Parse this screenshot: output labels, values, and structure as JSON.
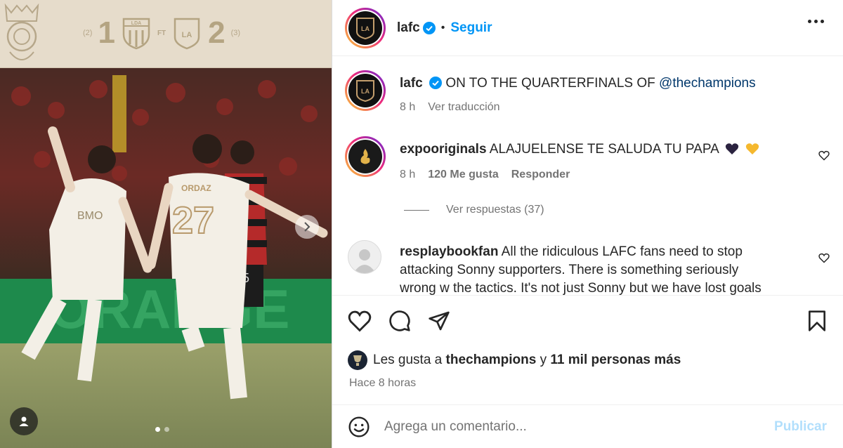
{
  "scoreboard": {
    "home_aggregate": "(2)",
    "home_goals": "1",
    "home_crest": "LDA",
    "status": "FT",
    "away_crest": "LAFC",
    "away_goals": "2",
    "away_aggregate": "(3)"
  },
  "photo": {
    "ad_board_text": "ORANGE",
    "player_left_shirt": "BMO",
    "player_center_name": "ORDAZ",
    "player_center_number": "27",
    "player_right_number": "25"
  },
  "carousel": {
    "slides": 2,
    "active": 1
  },
  "header": {
    "username": "lafc",
    "separator": "•",
    "follow_label": "Seguir"
  },
  "caption": {
    "username": "lafc",
    "text": "ON TO THE QUARTERFINALS OF",
    "mention": "@thechampions",
    "age": "8 h",
    "translate_label": "Ver traducción"
  },
  "comments": [
    {
      "username": "expooriginals",
      "text": "ALAJUELENSE TE SALUDA TU PAPA",
      "emojis": [
        "black-heart",
        "yellow-heart"
      ],
      "age": "8 h",
      "likes": "120 Me gusta",
      "reply_label": "Responder",
      "view_replies_label": "Ver respuestas (37)"
    },
    {
      "username": "resplaybookfan",
      "line1": "All the ridiculous LAFC fans need to stop",
      "line2": "attacking Sonny supporters. There is something seriously",
      "line3": "wrong w the tactics. It's not just Sonny but we have lost goals"
    }
  ],
  "likes": {
    "prefix": "Les gusta a",
    "account": "thechampions",
    "joiner": "y",
    "others": "11 mil personas más"
  },
  "timestamp": "Hace 8 horas",
  "composer": {
    "placeholder": "Agrega un comentario...",
    "publish_label": "Publicar"
  },
  "colors": {
    "link_blue": "#0095f6",
    "publish_disabled": "#b2dffc",
    "mention": "#00376b",
    "muted": "#737373",
    "lafc_gold": "#c39e6d"
  }
}
